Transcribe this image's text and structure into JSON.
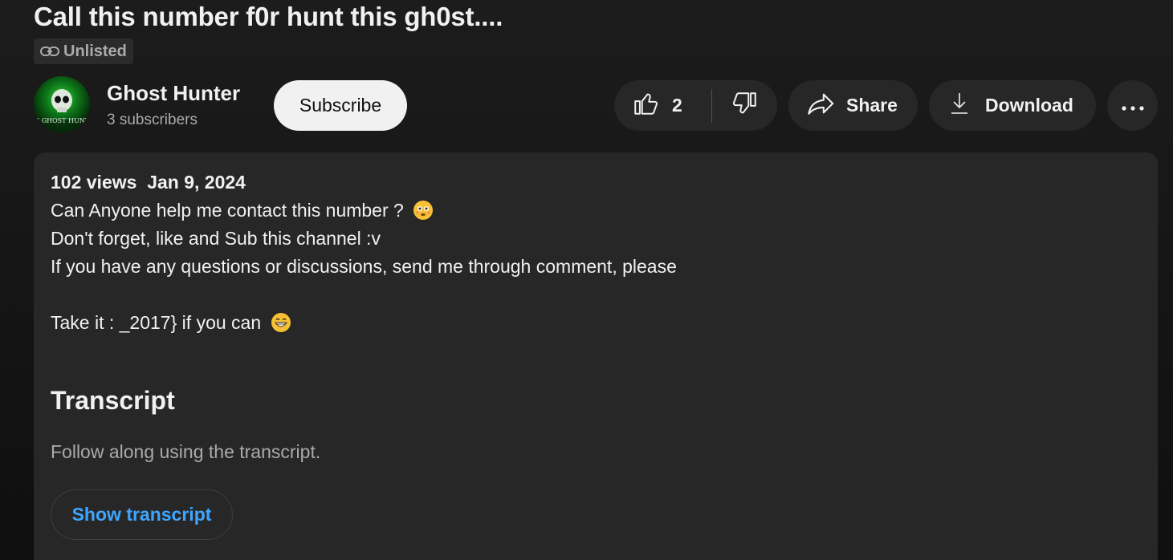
{
  "video": {
    "title": "Call this number f0r hunt this gh0st....",
    "visibility": "Unlisted"
  },
  "channel": {
    "name": "Ghost Hunter",
    "subscribers": "3 subscribers",
    "avatar_text": "THE GHOST HUNTER",
    "subscribe_label": "Subscribe"
  },
  "actions": {
    "like_count": "2",
    "share_label": "Share",
    "download_label": "Download"
  },
  "description": {
    "views": "102 views",
    "date": "Jan 9, 2024",
    "lines": [
      "Can Anyone help me contact this number ?",
      "Don't forget, like and Sub this channel :v",
      "If you have any questions or discussions, send me through comment, please",
      "Take it : _2017} if you can"
    ],
    "emoji_1": "flushed-face-emoji",
    "emoji_2": "grinning-face-emoji"
  },
  "transcript": {
    "title": "Transcript",
    "subtitle": "Follow along using the transcript.",
    "button_label": "Show transcript"
  },
  "colors": {
    "background": "#0f0f0f",
    "pill": "#272727",
    "accent_link": "#3ea6ff",
    "subscribe_bg": "#f1f1f1"
  }
}
